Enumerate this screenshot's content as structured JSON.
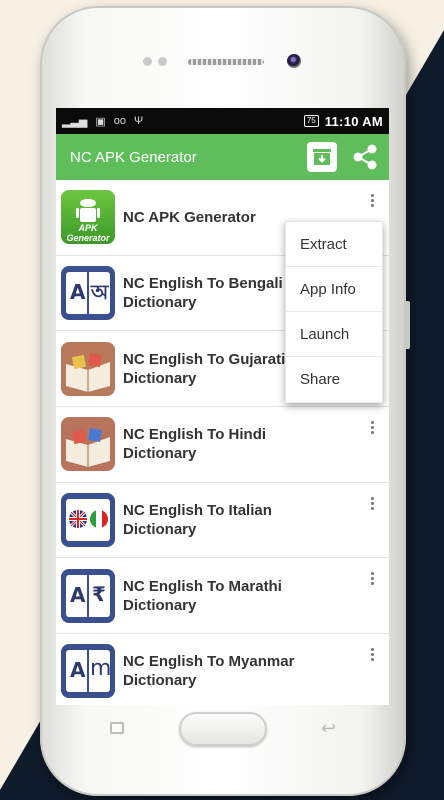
{
  "status_bar": {
    "battery": "75",
    "time": "11:10 AM"
  },
  "app_bar": {
    "title": "NC APK Generator",
    "download_icon": "download-box-icon",
    "share_icon": "share-icon"
  },
  "apps": [
    {
      "name": "NC APK Generator",
      "icon": "apk-generator-android-icon",
      "icon_text": "APK Generator"
    },
    {
      "name": "NC English To Bengali Dictionary",
      "icon": "bengali-dictionary-icon",
      "glyph_left": "A",
      "glyph_right": "অ"
    },
    {
      "name": "NC English To Gujarati Dictionary",
      "icon": "gujarati-dictionary-book-icon"
    },
    {
      "name": "NC English To Hindi Dictionary",
      "icon": "hindi-dictionary-book-icon"
    },
    {
      "name": "NC English To Italian Dictionary",
      "icon": "italian-dictionary-flags-icon"
    },
    {
      "name": "NC English To Marathi Dictionary",
      "icon": "marathi-dictionary-icon",
      "glyph_left": "A",
      "glyph_right": "₹"
    },
    {
      "name": "NC English To Myanmar Dictionary",
      "icon": "myanmar-dictionary-icon",
      "glyph_left": "A",
      "glyph_right": "m"
    }
  ],
  "context_menu": {
    "items": [
      "Extract",
      "App Info",
      "Launch",
      "Share"
    ]
  },
  "colors": {
    "app_bar": "#5fbd5c",
    "status_bar": "#0b0b0b",
    "background_light": "#f6f1e4",
    "background_dark": "#0f1a2a"
  }
}
